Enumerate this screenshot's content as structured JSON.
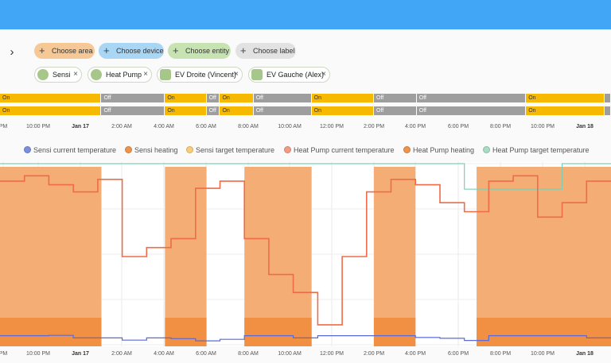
{
  "toolbar": {
    "choose_area": "Choose area",
    "choose_device": "Choose device",
    "choose_entity": "Choose entity",
    "choose_label": "Choose label"
  },
  "targets": [
    {
      "label": "Sensi",
      "icon": "thermostat-icon"
    },
    {
      "label": "Heat Pump",
      "icon": "thermostat-icon"
    },
    {
      "label": "EV Droite (Vincent)",
      "icon": "device-icon"
    },
    {
      "label": "EV Gauche (Alex)",
      "icon": "device-icon"
    }
  ],
  "timeline_rows": [
    [
      {
        "state": "On",
        "label": "On",
        "start": 0,
        "end": 0.166
      },
      {
        "state": "Off",
        "label": "Off",
        "start": 0.166,
        "end": 0.27
      },
      {
        "state": "On",
        "label": "On",
        "start": 0.27,
        "end": 0.338
      },
      {
        "state": "Off",
        "label": "Off",
        "start": 0.338,
        "end": 0.36
      },
      {
        "state": "On",
        "label": "On",
        "start": 0.36,
        "end": 0.415
      },
      {
        "state": "Off",
        "label": "Off",
        "start": 0.415,
        "end": 0.51
      },
      {
        "state": "On",
        "label": "On",
        "start": 0.51,
        "end": 0.612
      },
      {
        "state": "Off",
        "label": "Off",
        "start": 0.612,
        "end": 0.682
      },
      {
        "state": "Off",
        "label": "Off",
        "start": 0.682,
        "end": 0.861
      },
      {
        "state": "On",
        "label": "On",
        "start": 0.861,
        "end": 0.99
      },
      {
        "state": "Off",
        "label": "",
        "start": 0.99,
        "end": 1.0
      }
    ],
    [
      {
        "state": "On",
        "label": "On",
        "start": 0,
        "end": 0.166
      },
      {
        "state": "Off",
        "label": "Off",
        "start": 0.166,
        "end": 0.27
      },
      {
        "state": "On",
        "label": "On",
        "start": 0.27,
        "end": 0.338
      },
      {
        "state": "Off",
        "label": "Off",
        "start": 0.338,
        "end": 0.36
      },
      {
        "state": "On",
        "label": "On",
        "start": 0.36,
        "end": 0.415
      },
      {
        "state": "Off",
        "label": "Off",
        "start": 0.415,
        "end": 0.51
      },
      {
        "state": "On",
        "label": "On",
        "start": 0.51,
        "end": 0.612
      },
      {
        "state": "Off",
        "label": "Off",
        "start": 0.612,
        "end": 0.682
      },
      {
        "state": "Off",
        "label": "Off",
        "start": 0.682,
        "end": 0.861
      },
      {
        "state": "On",
        "label": "On",
        "start": 0.861,
        "end": 0.99
      },
      {
        "state": "Off",
        "label": "",
        "start": 0.99,
        "end": 1.0
      }
    ]
  ],
  "time_axis": [
    {
      "label": "PM",
      "bold": false
    },
    {
      "label": "10:00 PM",
      "bold": false
    },
    {
      "label": "Jan 17",
      "bold": true
    },
    {
      "label": "2:00 AM",
      "bold": false
    },
    {
      "label": "4:00 AM",
      "bold": false
    },
    {
      "label": "6:00 AM",
      "bold": false
    },
    {
      "label": "8:00 AM",
      "bold": false
    },
    {
      "label": "10:00 AM",
      "bold": false
    },
    {
      "label": "12:00 PM",
      "bold": false
    },
    {
      "label": "2:00 PM",
      "bold": false
    },
    {
      "label": "4:00 PM",
      "bold": false
    },
    {
      "label": "6:00 PM",
      "bold": false
    },
    {
      "label": "8:00 PM",
      "bold": false
    },
    {
      "label": "10:00 PM",
      "bold": false
    },
    {
      "label": "Jan 18",
      "bold": true
    }
  ],
  "legend": [
    {
      "label": "Sensi current temperature",
      "color": "#7b8ede"
    },
    {
      "label": "Sensi heating",
      "color": "#f0924a"
    },
    {
      "label": "Sensi target temperature",
      "color": "#f9cc7a"
    },
    {
      "label": "Heat Pump current temperature",
      "color": "#f39a85"
    },
    {
      "label": "Heat Pump heating",
      "color": "#f0924a"
    },
    {
      "label": "Heat Pump target temperature",
      "color": "#a8dcc6"
    }
  ],
  "colors": {
    "on": "#f7b900",
    "off": "#9e9e9e",
    "heating_fill": "#f5ad76",
    "heating_strong": "#f08a3a",
    "hp_line": "#ef6c48",
    "sensi_line": "#5a6bd8",
    "target_line": "#7ccfb3"
  },
  "chart_data": {
    "type": "area",
    "x_labels": [
      "PM",
      "10:00 PM",
      "Jan 17",
      "2:00 AM",
      "4:00 AM",
      "6:00 AM",
      "8:00 AM",
      "10:00 AM",
      "12:00 PM",
      "2:00 PM",
      "4:00 PM",
      "6:00 PM",
      "8:00 PM",
      "10:00 PM",
      "Jan 18"
    ],
    "heat_pump_heating_periods": [
      [
        0,
        0.166
      ],
      [
        0.27,
        0.338
      ],
      [
        0.4,
        0.51
      ],
      [
        0.612,
        0.68
      ],
      [
        0.78,
        1.0
      ]
    ],
    "series": [
      {
        "name": "Heat Pump current temperature",
        "values": [
          0.92,
          0.95,
          0.9,
          0.86,
          0.93,
          0.5,
          0.55,
          0.6,
          0.88,
          0.92,
          0.6,
          0.4,
          0.3,
          0.12,
          0.5,
          0.86,
          0.93,
          0.9,
          0.8,
          0.75,
          0.92,
          0.95,
          0.72,
          0.8,
          0.92
        ]
      },
      {
        "name": "Heat Pump target temperature",
        "values": [
          1.0,
          1.0,
          1.0,
          1.0,
          1.0,
          1.0,
          1.0,
          1.0,
          1.0,
          1.0,
          1.0,
          1.0,
          1.0,
          1.0,
          1.0,
          1.0,
          1.0,
          1.0,
          1.0,
          0.86,
          0.86,
          0.86,
          0.86,
          1.0,
          1.0
        ]
      },
      {
        "name": "Sensi current temperature",
        "values": [
          0.16,
          0.16,
          0.17,
          0.1,
          0.1,
          0.04,
          0.1,
          0.08,
          0.02,
          0.06,
          0.16,
          0.16,
          0.1,
          0.16,
          0.16,
          0.16,
          0.16,
          0.11,
          0.09,
          0.03,
          0.16,
          0.16,
          0.16,
          0.16,
          0.1
        ]
      }
    ]
  }
}
